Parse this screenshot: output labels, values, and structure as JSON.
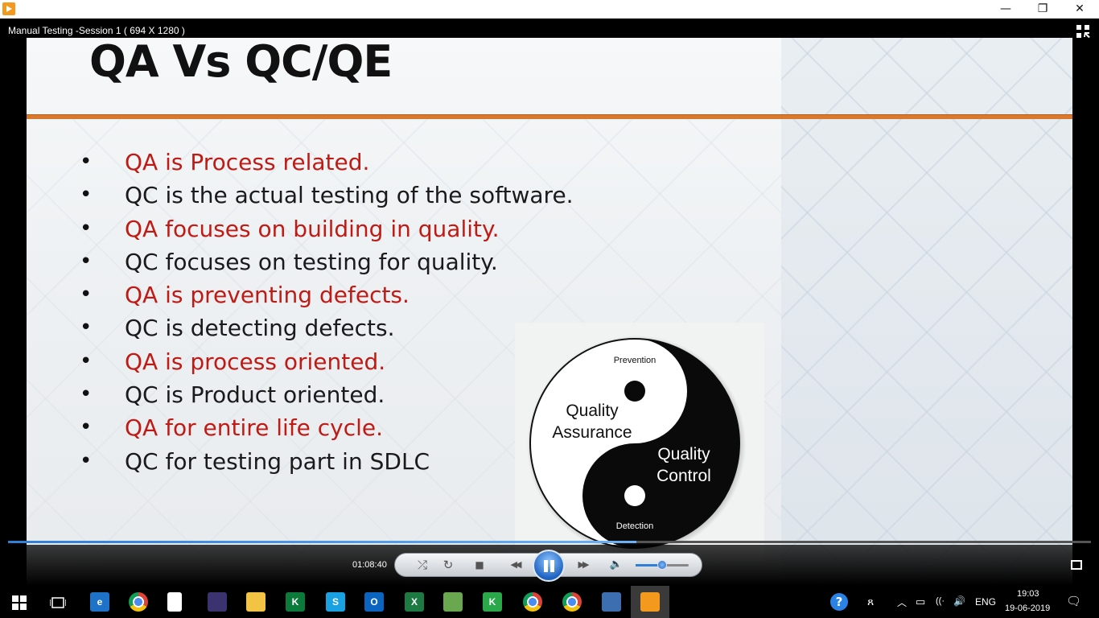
{
  "window": {
    "minimize_glyph": "—",
    "restore_glyph": "❐",
    "close_glyph": "✕"
  },
  "video": {
    "title": "Manual Testing -Session 1 ( 694 X 1280 )",
    "progress_fraction": 0.58
  },
  "slide": {
    "title": "QA Vs QC/QE",
    "bullets": [
      {
        "text": "QA is Process related.",
        "color": "#c01a14"
      },
      {
        "text": "QC is the actual testing of the software.",
        "color": "#1a1a1a"
      },
      {
        "text": "QA focuses on building in quality.",
        "color": "#c01a14"
      },
      {
        "text": "QC focuses on testing for quality.",
        "color": "#1a1a1a"
      },
      {
        "text": "QA is preventing defects.",
        "color": "#c01a14"
      },
      {
        "text": "QC is detecting defects.",
        "color": "#1a1a1a"
      },
      {
        "text": "QA is process oriented.",
        "color": "#c01a14"
      },
      {
        "text": "QC is Product oriented.",
        "color": "#1a1a1a"
      },
      {
        "text": "QA for entire life cycle.",
        "color": "#c01a14"
      },
      {
        "text": "QC for testing part in SDLC",
        "color": "#1a1a1a"
      }
    ],
    "yin_yang": {
      "top_label": "Prevention",
      "left_label_1": "Quality",
      "left_label_2": "Assurance",
      "right_label_1": "Quality",
      "right_label_2": "Control",
      "bottom_label": "Detection"
    }
  },
  "player": {
    "elapsed": "01:08:40",
    "volume_fraction": 0.5,
    "shuffle_glyph": "⤮",
    "repeat_glyph": "↻",
    "stop_glyph": "■",
    "prev_glyph": "◀◀",
    "next_glyph": "▶▶",
    "volume_glyph": "🔈"
  },
  "taskbar": {
    "apps": [
      {
        "name": "edge",
        "label": "e",
        "color": "#1e73c8"
      },
      {
        "name": "chrome",
        "label": "",
        "color": "chrome"
      },
      {
        "name": "file",
        "label": "",
        "color": "#ffffff"
      },
      {
        "name": "eclipse",
        "label": "",
        "color": "#3b3270"
      },
      {
        "name": "file-explorer",
        "label": "",
        "color": "#f3c343"
      },
      {
        "name": "kite",
        "label": "K",
        "color": "#0b7a3b"
      },
      {
        "name": "skype",
        "label": "S",
        "color": "#1aa1e1"
      },
      {
        "name": "outlook",
        "label": "O",
        "color": "#0b64c0"
      },
      {
        "name": "excel",
        "label": "X",
        "color": "#1d7a43"
      },
      {
        "name": "project",
        "label": "",
        "color": "#6aa84f"
      },
      {
        "name": "kite2",
        "label": "K",
        "color": "#2aa84a"
      },
      {
        "name": "chrome2",
        "label": "",
        "color": "chrome"
      },
      {
        "name": "chrome3",
        "label": "",
        "color": "chrome"
      },
      {
        "name": "remote",
        "label": "",
        "color": "#3d6fb0"
      },
      {
        "name": "media-player",
        "label": "",
        "color": "#f39a1e"
      }
    ],
    "help_glyph": "?",
    "people_glyph": "ጸ",
    "chevron_glyph": "︿",
    "network_glyph": "((·",
    "speaker_glyph": "🔊",
    "battery_glyph": "▭",
    "language": "ENG",
    "time": "19:03",
    "date": "19-06-2019",
    "notification_glyph": "🗨"
  }
}
